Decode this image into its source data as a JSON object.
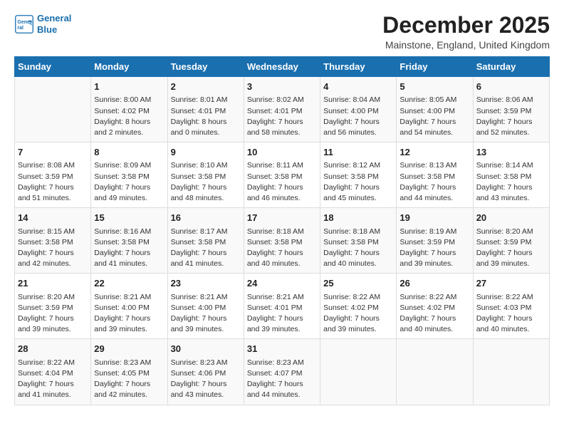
{
  "logo": {
    "line1": "General",
    "line2": "Blue"
  },
  "title": "December 2025",
  "subtitle": "Mainstone, England, United Kingdom",
  "days_header": [
    "Sunday",
    "Monday",
    "Tuesday",
    "Wednesday",
    "Thursday",
    "Friday",
    "Saturday"
  ],
  "weeks": [
    [
      {
        "num": "",
        "sunrise": "",
        "sunset": "",
        "daylight": ""
      },
      {
        "num": "1",
        "sunrise": "Sunrise: 8:00 AM",
        "sunset": "Sunset: 4:02 PM",
        "daylight": "Daylight: 8 hours and 2 minutes."
      },
      {
        "num": "2",
        "sunrise": "Sunrise: 8:01 AM",
        "sunset": "Sunset: 4:01 PM",
        "daylight": "Daylight: 8 hours and 0 minutes."
      },
      {
        "num": "3",
        "sunrise": "Sunrise: 8:02 AM",
        "sunset": "Sunset: 4:01 PM",
        "daylight": "Daylight: 7 hours and 58 minutes."
      },
      {
        "num": "4",
        "sunrise": "Sunrise: 8:04 AM",
        "sunset": "Sunset: 4:00 PM",
        "daylight": "Daylight: 7 hours and 56 minutes."
      },
      {
        "num": "5",
        "sunrise": "Sunrise: 8:05 AM",
        "sunset": "Sunset: 4:00 PM",
        "daylight": "Daylight: 7 hours and 54 minutes."
      },
      {
        "num": "6",
        "sunrise": "Sunrise: 8:06 AM",
        "sunset": "Sunset: 3:59 PM",
        "daylight": "Daylight: 7 hours and 52 minutes."
      }
    ],
    [
      {
        "num": "7",
        "sunrise": "Sunrise: 8:08 AM",
        "sunset": "Sunset: 3:59 PM",
        "daylight": "Daylight: 7 hours and 51 minutes."
      },
      {
        "num": "8",
        "sunrise": "Sunrise: 8:09 AM",
        "sunset": "Sunset: 3:58 PM",
        "daylight": "Daylight: 7 hours and 49 minutes."
      },
      {
        "num": "9",
        "sunrise": "Sunrise: 8:10 AM",
        "sunset": "Sunset: 3:58 PM",
        "daylight": "Daylight: 7 hours and 48 minutes."
      },
      {
        "num": "10",
        "sunrise": "Sunrise: 8:11 AM",
        "sunset": "Sunset: 3:58 PM",
        "daylight": "Daylight: 7 hours and 46 minutes."
      },
      {
        "num": "11",
        "sunrise": "Sunrise: 8:12 AM",
        "sunset": "Sunset: 3:58 PM",
        "daylight": "Daylight: 7 hours and 45 minutes."
      },
      {
        "num": "12",
        "sunrise": "Sunrise: 8:13 AM",
        "sunset": "Sunset: 3:58 PM",
        "daylight": "Daylight: 7 hours and 44 minutes."
      },
      {
        "num": "13",
        "sunrise": "Sunrise: 8:14 AM",
        "sunset": "Sunset: 3:58 PM",
        "daylight": "Daylight: 7 hours and 43 minutes."
      }
    ],
    [
      {
        "num": "14",
        "sunrise": "Sunrise: 8:15 AM",
        "sunset": "Sunset: 3:58 PM",
        "daylight": "Daylight: 7 hours and 42 minutes."
      },
      {
        "num": "15",
        "sunrise": "Sunrise: 8:16 AM",
        "sunset": "Sunset: 3:58 PM",
        "daylight": "Daylight: 7 hours and 41 minutes."
      },
      {
        "num": "16",
        "sunrise": "Sunrise: 8:17 AM",
        "sunset": "Sunset: 3:58 PM",
        "daylight": "Daylight: 7 hours and 41 minutes."
      },
      {
        "num": "17",
        "sunrise": "Sunrise: 8:18 AM",
        "sunset": "Sunset: 3:58 PM",
        "daylight": "Daylight: 7 hours and 40 minutes."
      },
      {
        "num": "18",
        "sunrise": "Sunrise: 8:18 AM",
        "sunset": "Sunset: 3:58 PM",
        "daylight": "Daylight: 7 hours and 40 minutes."
      },
      {
        "num": "19",
        "sunrise": "Sunrise: 8:19 AM",
        "sunset": "Sunset: 3:59 PM",
        "daylight": "Daylight: 7 hours and 39 minutes."
      },
      {
        "num": "20",
        "sunrise": "Sunrise: 8:20 AM",
        "sunset": "Sunset: 3:59 PM",
        "daylight": "Daylight: 7 hours and 39 minutes."
      }
    ],
    [
      {
        "num": "21",
        "sunrise": "Sunrise: 8:20 AM",
        "sunset": "Sunset: 3:59 PM",
        "daylight": "Daylight: 7 hours and 39 minutes."
      },
      {
        "num": "22",
        "sunrise": "Sunrise: 8:21 AM",
        "sunset": "Sunset: 4:00 PM",
        "daylight": "Daylight: 7 hours and 39 minutes."
      },
      {
        "num": "23",
        "sunrise": "Sunrise: 8:21 AM",
        "sunset": "Sunset: 4:00 PM",
        "daylight": "Daylight: 7 hours and 39 minutes."
      },
      {
        "num": "24",
        "sunrise": "Sunrise: 8:21 AM",
        "sunset": "Sunset: 4:01 PM",
        "daylight": "Daylight: 7 hours and 39 minutes."
      },
      {
        "num": "25",
        "sunrise": "Sunrise: 8:22 AM",
        "sunset": "Sunset: 4:02 PM",
        "daylight": "Daylight: 7 hours and 39 minutes."
      },
      {
        "num": "26",
        "sunrise": "Sunrise: 8:22 AM",
        "sunset": "Sunset: 4:02 PM",
        "daylight": "Daylight: 7 hours and 40 minutes."
      },
      {
        "num": "27",
        "sunrise": "Sunrise: 8:22 AM",
        "sunset": "Sunset: 4:03 PM",
        "daylight": "Daylight: 7 hours and 40 minutes."
      }
    ],
    [
      {
        "num": "28",
        "sunrise": "Sunrise: 8:22 AM",
        "sunset": "Sunset: 4:04 PM",
        "daylight": "Daylight: 7 hours and 41 minutes."
      },
      {
        "num": "29",
        "sunrise": "Sunrise: 8:23 AM",
        "sunset": "Sunset: 4:05 PM",
        "daylight": "Daylight: 7 hours and 42 minutes."
      },
      {
        "num": "30",
        "sunrise": "Sunrise: 8:23 AM",
        "sunset": "Sunset: 4:06 PM",
        "daylight": "Daylight: 7 hours and 43 minutes."
      },
      {
        "num": "31",
        "sunrise": "Sunrise: 8:23 AM",
        "sunset": "Sunset: 4:07 PM",
        "daylight": "Daylight: 7 hours and 44 minutes."
      },
      {
        "num": "",
        "sunrise": "",
        "sunset": "",
        "daylight": ""
      },
      {
        "num": "",
        "sunrise": "",
        "sunset": "",
        "daylight": ""
      },
      {
        "num": "",
        "sunrise": "",
        "sunset": "",
        "daylight": ""
      }
    ]
  ]
}
